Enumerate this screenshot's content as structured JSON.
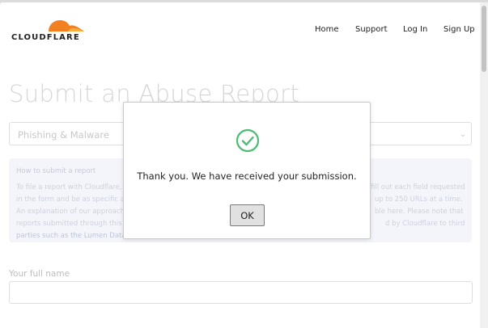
{
  "header": {
    "logo_text": "CLOUDFLARE",
    "nav": [
      "Home",
      "Support",
      "Log In",
      "Sign Up"
    ]
  },
  "page": {
    "title": "Submit an Abuse Report",
    "report_type": "Phishing & Malware",
    "info": {
      "title": "How to submit a report",
      "lines": [
        [
          "To file a report with Cloudflare, pl",
          "fill out each field requested"
        ],
        [
          "in the form and be as specific as p",
          "up to 250 URLs at a time."
        ],
        [
          "An explanation of our approach t",
          "ble here. Please note that"
        ],
        [
          "reports submitted through this fo",
          "d by Cloudflare to third"
        ],
        [
          "parties such as the Lumen Databa",
          ""
        ]
      ]
    },
    "full_name_label": "Your full name",
    "full_name_value": ""
  },
  "modal": {
    "message": "Thank you. We have received your submission.",
    "ok_label": "OK"
  },
  "colors": {
    "brand_orange": "#f38020",
    "success_green": "#4cbb74"
  }
}
